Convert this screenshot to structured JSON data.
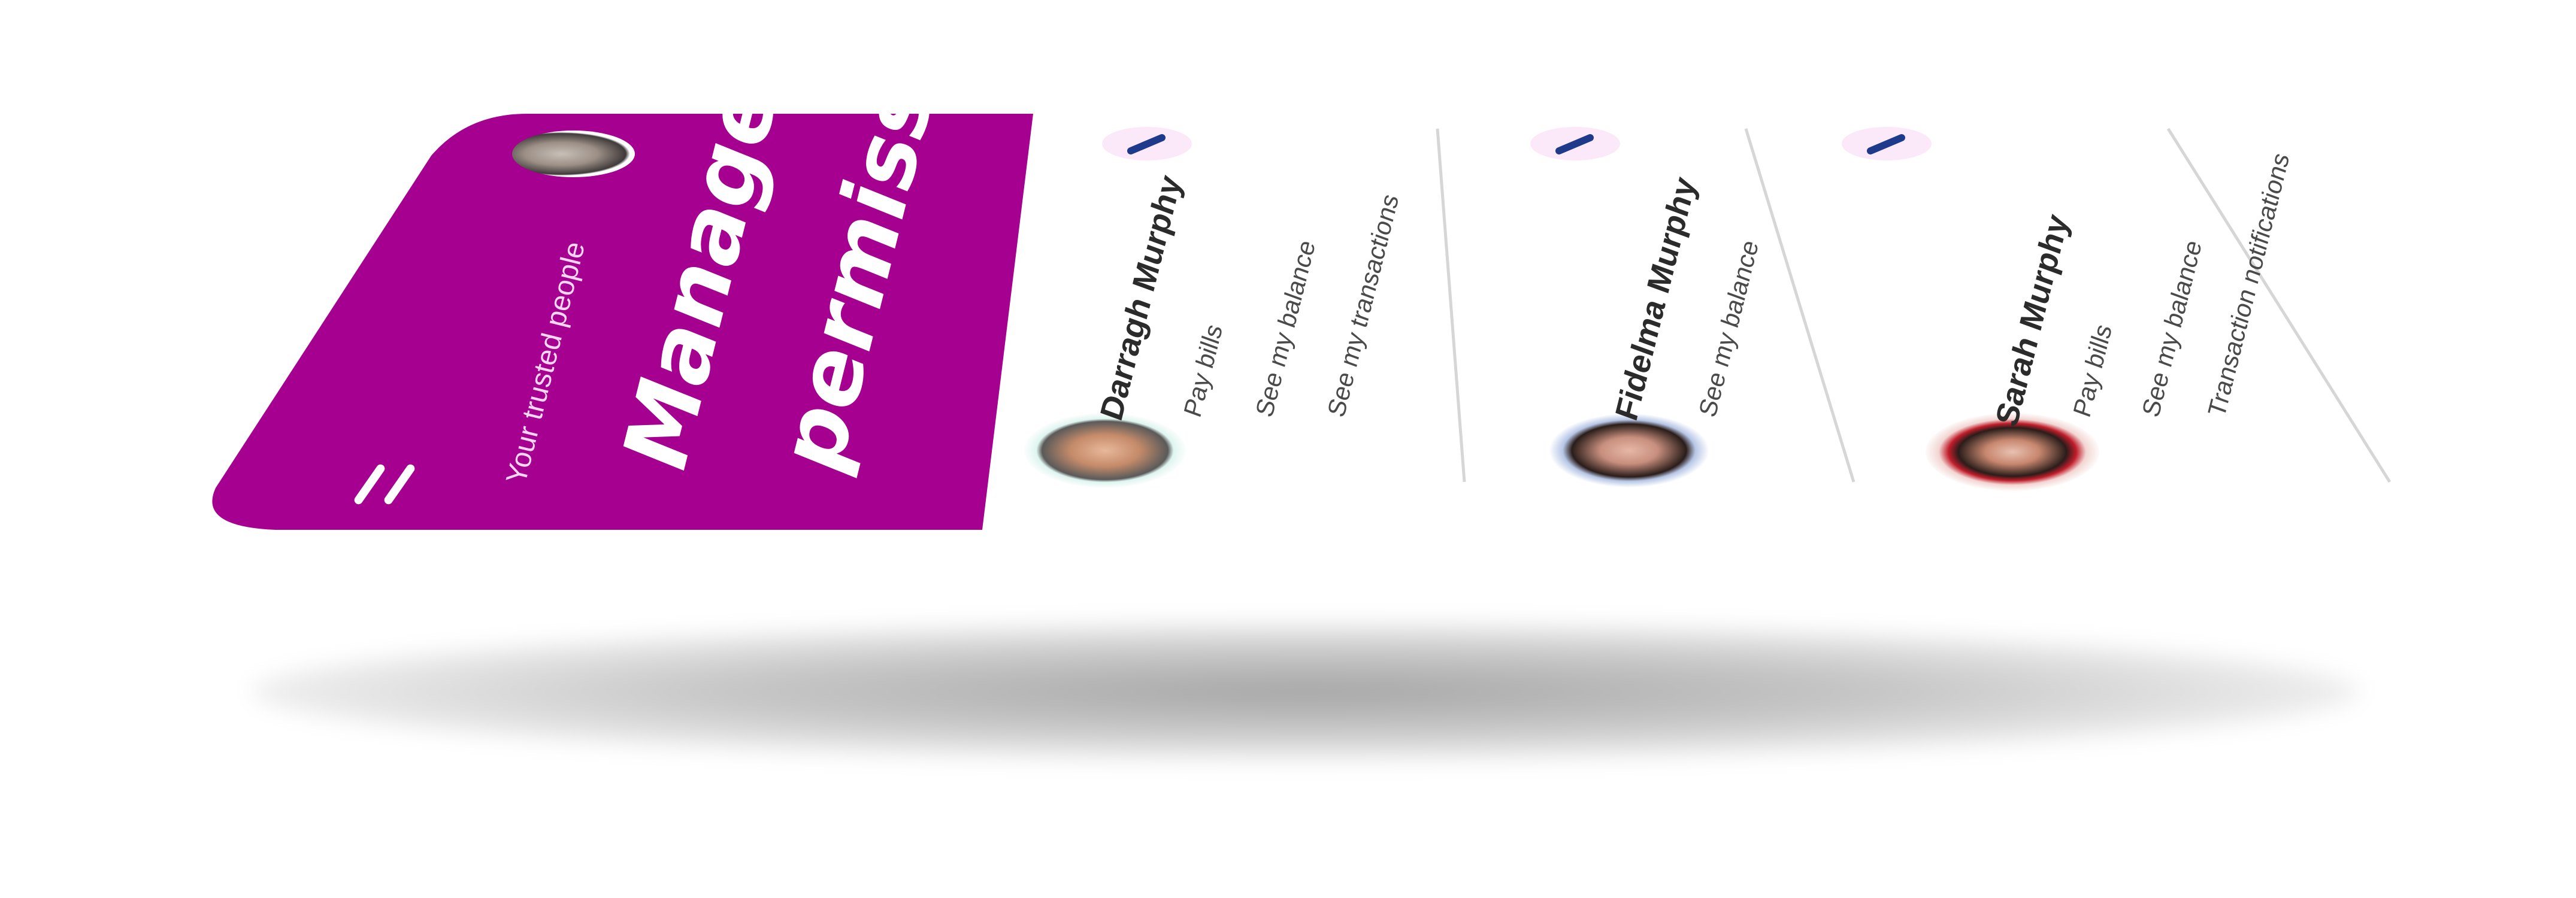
{
  "header": {
    "subtitle": "Your trusted people",
    "title_line1": "Manage",
    "title_line2": "permissions"
  },
  "icons": {
    "menu": "menu-icon",
    "profile": "profile-avatar",
    "edit": "pencil-icon"
  },
  "colors": {
    "brand": "#a5008f",
    "card_bg": "#ffffff",
    "edit_bg": "#fbe8f9",
    "edit_icon": "#1e3a8a",
    "divider": "#d6d6d6"
  },
  "people": [
    {
      "name": "Darragh Murphy",
      "permissions": [
        "Pay bills",
        "See my balance",
        "See my transactions"
      ]
    },
    {
      "name": "Fidelma Murphy",
      "permissions": [
        "See my balance"
      ]
    },
    {
      "name": "Sarah Murphy",
      "permissions": [
        "Pay bills",
        "See my balance",
        "Transaction notifications"
      ]
    }
  ]
}
